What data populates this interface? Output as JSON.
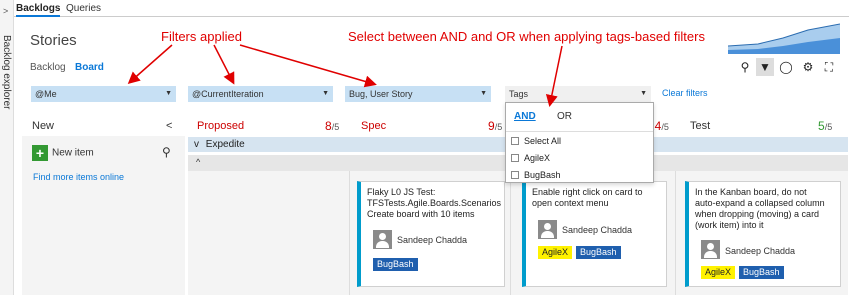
{
  "side_rail": {
    "label": "Backlog explorer",
    "chevron": ">"
  },
  "top_tabs": [
    {
      "label": "Backlogs",
      "active": true
    },
    {
      "label": "Queries",
      "active": false
    }
  ],
  "page_title": "Stories",
  "view_tabs": [
    {
      "label": "Backlog",
      "active": false
    },
    {
      "label": "Board",
      "active": true
    }
  ],
  "toolbar_icons": [
    "search-icon",
    "filter-icon",
    "broadcast-icon",
    "gear-icon",
    "fullscreen-icon"
  ],
  "filters": {
    "assigned": "@Me",
    "iteration": "@CurrentIteration",
    "work_item_type": "Bug, User Story",
    "tags_placeholder": "Tags",
    "clear_label": "Clear filters"
  },
  "tags_dropdown": {
    "logic_and": "AND",
    "logic_or": "OR",
    "options": [
      "Select All",
      "AgileX",
      "BugBash"
    ]
  },
  "columns": {
    "new": {
      "title": "New",
      "collapse": "<"
    },
    "proposed": {
      "title": "Proposed",
      "count": "8",
      "limit": "/5"
    },
    "spec": {
      "title": "Spec",
      "count": "9",
      "limit": "/5"
    },
    "build": {
      "count": "24",
      "limit": "/5"
    },
    "test": {
      "title": "Test",
      "count": "5",
      "limit": "/5"
    }
  },
  "new_column": {
    "new_item_label": "New item",
    "find_items_label": "Find more items online"
  },
  "swimlane": {
    "label": "Expedite",
    "chevron": "v",
    "lane_chevron": "^"
  },
  "cards": [
    {
      "title_lines": [
        "Flaky L0 JS Test:",
        "TFSTests.Agile.Boards.Scenarios",
        "Create board with 10 items"
      ],
      "owner": "Sandeep Chadda",
      "tags": [
        "BugBash"
      ]
    },
    {
      "title_lines": [
        "Enable right click on card to",
        "open context menu"
      ],
      "owner": "Sandeep Chadda",
      "tags": [
        "AgileX",
        "BugBash"
      ]
    },
    {
      "title_lines": [
        "In the Kanban board, do not",
        "auto-expand a collapsed column",
        "when dropping (moving) a card",
        "(work item) into it"
      ],
      "owner": "Sandeep Chadda",
      "tags": [
        "AgileX",
        "BugBash"
      ]
    }
  ],
  "annotations": {
    "filters_applied": "Filters applied",
    "and_or": "Select between AND and OR when applying tags-based filters"
  },
  "colors": {
    "accent": "#0a78d7",
    "annotation": "#e00000",
    "filter_bg": "#c7e0f4",
    "card_stripe": "#009ccc",
    "bugbash": "#1f5fae",
    "agilex": "#fff200",
    "over_limit": "#cc0000",
    "under_limit": "#339933"
  }
}
